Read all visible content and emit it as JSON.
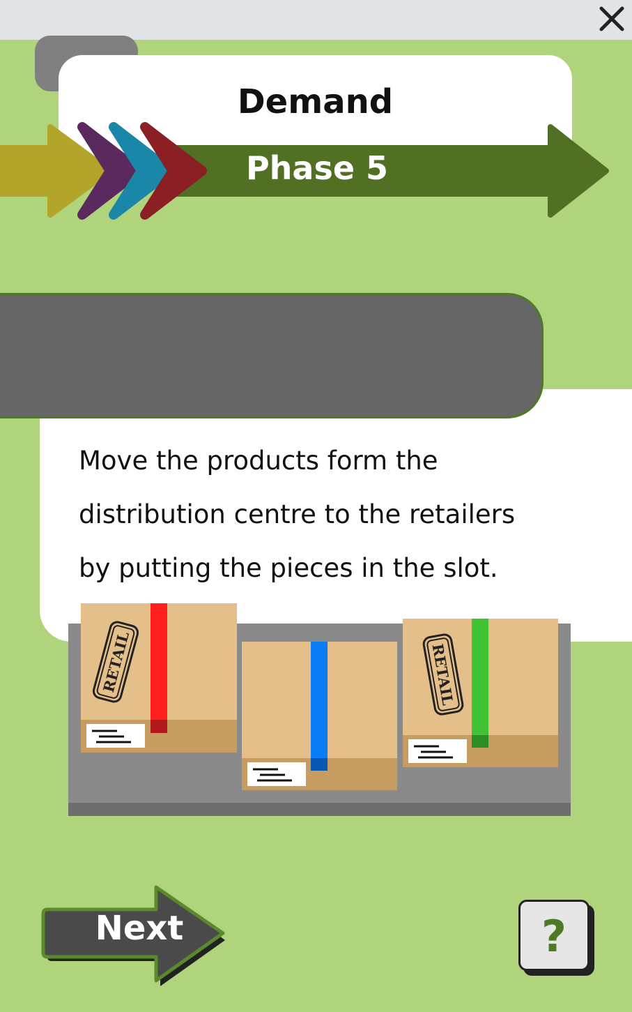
{
  "title": "Demand",
  "phase_label": "Phase 5",
  "instruction_lines": [
    "Move the products form the",
    "distribution centre to the retailers",
    "by putting the pieces in the slot."
  ],
  "boxes": [
    {
      "stamp": "RETAIL",
      "tape_color": "#ff1f1f"
    },
    {
      "stamp": "",
      "tape_color": "#0a7cf5"
    },
    {
      "stamp": "RETAIL",
      "tape_color": "#3fc234"
    }
  ],
  "buttons": {
    "next_label": "Next",
    "help_label": "?",
    "close_icon": "close-icon"
  },
  "colors": {
    "background": "#afd47b",
    "phase_green": "#527023",
    "chevron_olive": "#b2a52a",
    "chevron_purple": "#5a2a5e",
    "chevron_teal": "#1a86a8",
    "chevron_red": "#8a1f24",
    "box_cardboard": "#e4bf8a"
  }
}
